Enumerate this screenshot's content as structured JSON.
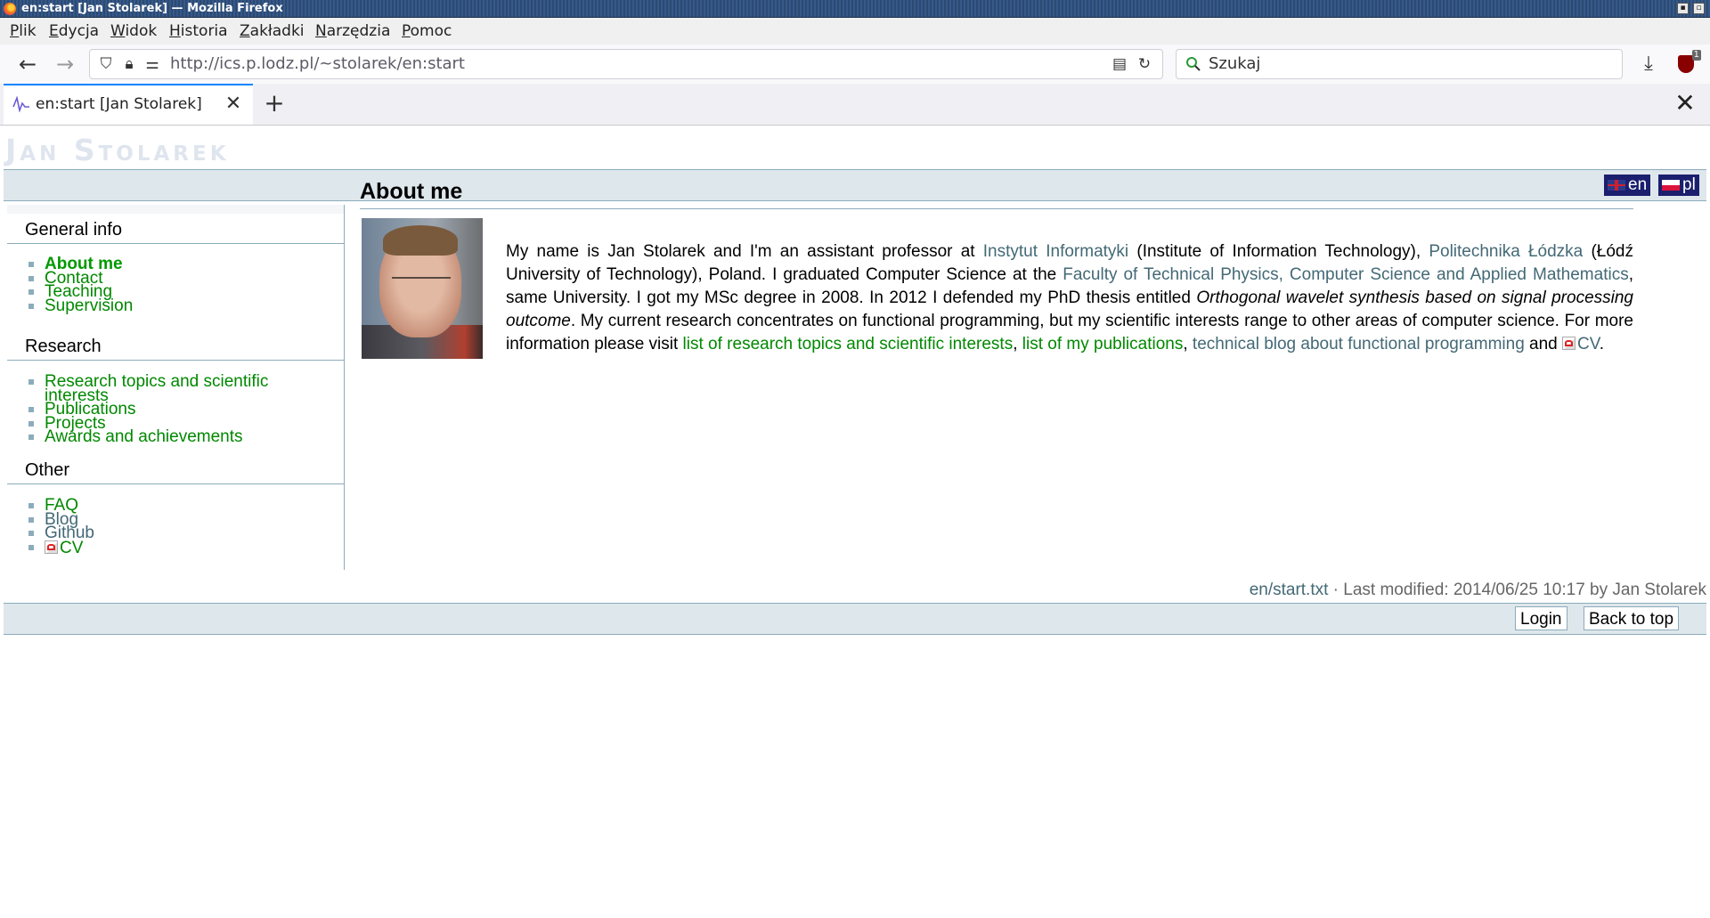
{
  "window": {
    "title": "en:start [Jan Stolarek] — Mozilla Firefox"
  },
  "menubar": {
    "items": [
      "Plik",
      "Edycja",
      "Widok",
      "Historia",
      "Zakładki",
      "Narzędzia",
      "Pomoc"
    ]
  },
  "navbar": {
    "url": "http://ics.p.lodz.pl/~stolarek/en:start",
    "search_placeholder": "Szukaj",
    "extension_badge": "1"
  },
  "tabs": [
    {
      "title": "en:start [Jan Stolarek]",
      "active": true
    }
  ],
  "site": {
    "title": "Jan Stolarek",
    "languages": [
      {
        "code": "en",
        "label": "en"
      },
      {
        "code": "pl",
        "label": "pl"
      }
    ]
  },
  "sidebar": {
    "sections": [
      {
        "heading": "General info",
        "items": [
          "About me",
          "Contact",
          "Teaching",
          "Supervision"
        ]
      },
      {
        "heading": "Research",
        "items": [
          "Research topics and scientific interests",
          "Publications",
          "Projects",
          "Awards and achievements"
        ]
      },
      {
        "heading": "Other",
        "items": [
          "FAQ",
          "Blog",
          "Github",
          "CV"
        ]
      }
    ]
  },
  "content": {
    "heading": "About me",
    "bio": {
      "t1": "My name is Jan Stolarek and I'm an assistant professor at ",
      "l1": "Instytut Informatyki",
      "t2": " (Institute of Information Technology), ",
      "l2": "Politechnika Łódzka",
      "t3": " (Łódź University of Technology), Poland. I graduated Computer Science at the ",
      "l3": "Faculty of Technical Physics, Computer Science and Applied Mathematics",
      "t4": ", same University. I got my MSc degree in 2008. In 2012 I defended my PhD thesis entitled ",
      "em1": "Orthogonal wavelet synthesis based on signal processing outcome",
      "t5": ". My current research concentrates on functional programming, but my scientific interests range to other areas of computer science. For more information please visit ",
      "l4": "list of research topics and scientific interests",
      "t6": ", ",
      "l5": "list of my publications",
      "t7": ", ",
      "l6": "technical blog about functional programming",
      "t8": " and ",
      "l7": "CV",
      "t9": "."
    }
  },
  "footer": {
    "file": "en/start.txt",
    "modified": " · Last modified: 2014/06/25 10:17 by Jan Stolarek",
    "login_label": "Login",
    "top_label": "Back to top"
  }
}
